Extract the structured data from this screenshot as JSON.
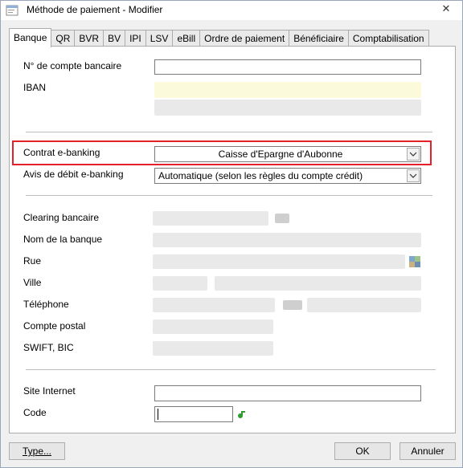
{
  "window": {
    "title": "Méthode de paiement - Modifier",
    "close_glyph": "✕"
  },
  "tabs": [
    "Banque",
    "QR",
    "BVR",
    "BV",
    "IPI",
    "LSV",
    "eBill",
    "Ordre de paiement",
    "Bénéficiaire",
    "Comptabilisation"
  ],
  "active_tab": "Banque",
  "form": {
    "account_number_label": "N° de compte bancaire",
    "iban_label": "IBAN",
    "ebanking_contract_label": "Contrat e-banking",
    "ebanking_contract_value": "Caisse d'Epargne d'Aubonne",
    "debit_notice_label": "Avis de débit e-banking",
    "debit_notice_value": "Automatique (selon les règles du compte crédit)",
    "clearing_label": "Clearing bancaire",
    "bank_name_label": "Nom de la banque",
    "street_label": "Rue",
    "city_label": "Ville",
    "phone_label": "Téléphone",
    "postal_account_label": "Compte postal",
    "swift_label": "SWIFT, BIC",
    "website_label": "Site Internet",
    "code_label": "Code",
    "code_value": ""
  },
  "buttons": {
    "type": "Type...",
    "ok": "OK",
    "cancel": "Annuler"
  },
  "icons": {
    "app": "app-window-icon",
    "close": "close-icon",
    "dropdown": "chevron-down-icon",
    "map": "map-icon",
    "key": "key-icon"
  },
  "colors": {
    "highlight_border": "#e4202a",
    "key_icon": "#2e9e2e"
  }
}
